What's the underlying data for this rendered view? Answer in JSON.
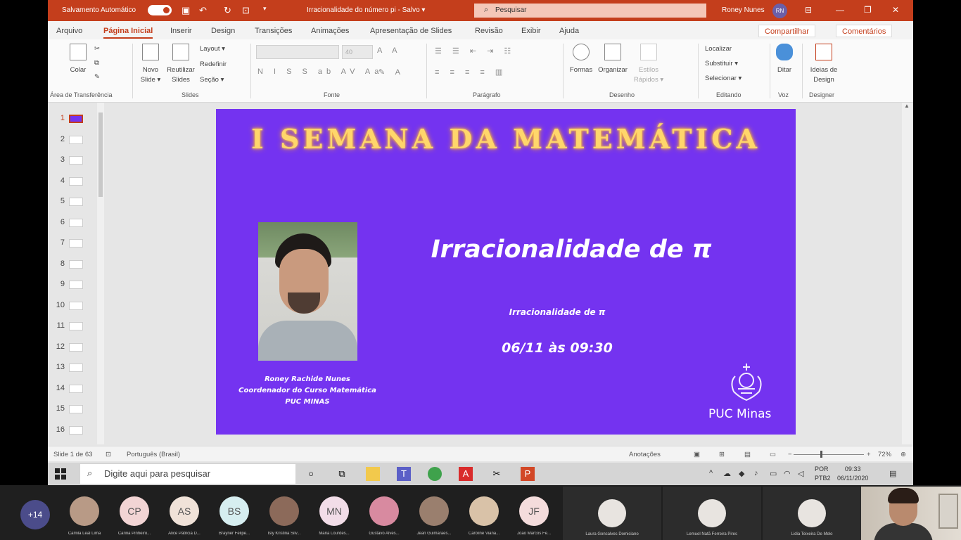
{
  "titlebar": {
    "autosave_label": "Salvamento Automático",
    "doc_title": "Irracionalidade do número pi  -  Salvo  ▾",
    "search_placeholder": "Pesquisar",
    "user_name": "Roney Nunes",
    "user_initials": "RN"
  },
  "tabs": [
    "Arquivo",
    "Página Inicial",
    "Inserir",
    "Design",
    "Transições",
    "Animações",
    "Apresentação de Slides",
    "Revisão",
    "Exibir",
    "Ajuda"
  ],
  "active_tab": "Página Inicial",
  "share_label": "Compartilhar",
  "comments_label": "Comentários",
  "ribbon": {
    "groups": [
      "Área de Transferência",
      "Slides",
      "Fonte",
      "Parágrafo",
      "Desenho",
      "Editando",
      "Voz",
      "Designer"
    ],
    "paste": "Colar",
    "new_slide": "Novo Slide ▾",
    "reuse_slides": "Reutilizar Slides",
    "layout": "Layout ▾",
    "reset": "Redefinir",
    "section": "Seção ▾",
    "font_size": "40",
    "shapes": "Formas",
    "arrange": "Organizar",
    "quick_styles": "Estilos Rápidos ▾",
    "find": "Localizar",
    "replace": "Substituir ▾",
    "select": "Selecionar ▾",
    "dictate": "Ditar",
    "design_ideas": "Ideias de Design"
  },
  "thumbnails": [
    "1",
    "2",
    "3",
    "4",
    "5",
    "6",
    "7",
    "8",
    "9",
    "10",
    "11",
    "12",
    "13",
    "14",
    "15",
    "16"
  ],
  "slide": {
    "title": "I SEMANA DA MATEMÁTICA",
    "subject": "Irracionalidade de π",
    "subtitle": "Irracionalidade de π",
    "datetime": "06/11 às 09:30",
    "presenter_name": "Roney Rachide Nunes",
    "presenter_role": "Coordenador do Curso Matemática",
    "presenter_org": "PUC MINAS",
    "logo_text": "PUC Minas",
    "background_color": "#7433f0",
    "title_color": "#ffd66b"
  },
  "status": {
    "slide_counter": "Slide 1 de 63",
    "language": "Português (Brasil)",
    "notes": "Anotações",
    "zoom": "72%"
  },
  "taskbar": {
    "search_placeholder": "Digite aqui para pesquisar",
    "lang1": "POR",
    "lang2": "PTB2",
    "time": "09:33",
    "date": "06/11/2020"
  },
  "meeting": {
    "more_count": "+14",
    "participants": [
      {
        "initials": "",
        "name": "Camila Leal Lima",
        "color": "#b89a86"
      },
      {
        "initials": "CP",
        "name": "Carina Pinheiro...",
        "color": "#f2d4d4"
      },
      {
        "initials": "AS",
        "name": "Alice Patricia D...",
        "color": "#f0e2d8"
      },
      {
        "initials": "BS",
        "name": "Brayner Felipe...",
        "color": "#d6eef0"
      },
      {
        "initials": "",
        "name": "Isly Kristina Silv...",
        "color": "#8c6a5a"
      },
      {
        "initials": "MN",
        "name": "Maria Lourdes...",
        "color": "#f2dde8"
      },
      {
        "initials": "",
        "name": "Gustavo Alves...",
        "color": "#d88aa0"
      },
      {
        "initials": "",
        "name": "Jean Guimaraes...",
        "color": "#9a7f6e"
      },
      {
        "initials": "",
        "name": "Caroline Viana...",
        "color": "#d9c2a8"
      },
      {
        "initials": "JF",
        "name": "João Marcos Fe...",
        "color": "#f4dcdc"
      }
    ],
    "video_tiles": [
      {
        "name": "Laura Goncalves Domiciano"
      },
      {
        "name": "Lemuel Natã Ferreira Pires"
      },
      {
        "name": "Lidia Teixeira De Melo"
      }
    ]
  }
}
